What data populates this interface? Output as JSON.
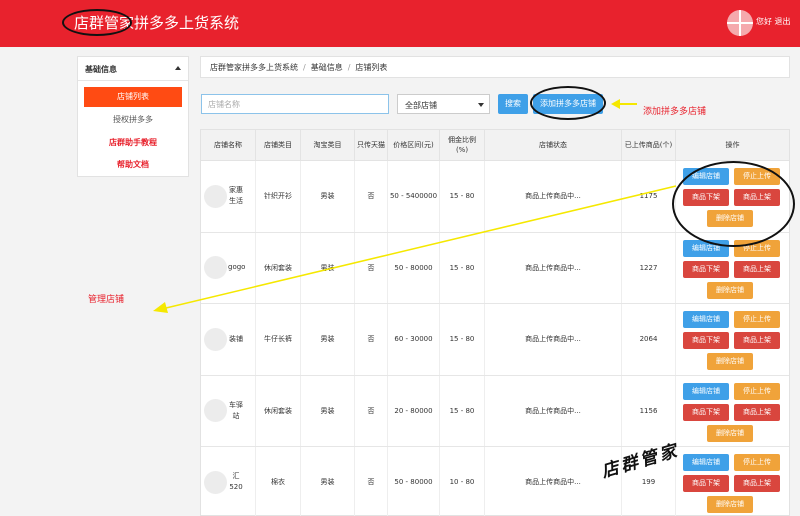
{
  "header": {
    "brand_prefix": "店群管家",
    "brand_suffix": "拼多多上货系统",
    "greeting": "您好",
    "logout": "退出"
  },
  "sidebar": {
    "section_title": "基础信息",
    "items": [
      {
        "label": "店铺列表",
        "state": "active"
      },
      {
        "label": "授权拼多多",
        "state": "normal"
      },
      {
        "label": "店群助手教程",
        "state": "highlight"
      },
      {
        "label": "帮助文档",
        "state": "highlight"
      }
    ]
  },
  "breadcrumb": {
    "items": [
      "店群管家拼多多上货系统",
      "基础信息",
      "店铺列表"
    ],
    "separator": "/"
  },
  "toolbar": {
    "search_placeholder": "店铺名称",
    "shop_select": "全部店铺",
    "search_label": "搜索",
    "add_label": "添加拼多多店铺"
  },
  "table": {
    "columns": [
      "店铺名称",
      "店铺类目",
      "淘宝类目",
      "只传天猫",
      "价格区间(元)",
      "佣金比例(%)",
      "店铺状态",
      "已上传商品(个)",
      "操作"
    ],
    "rows": [
      {
        "name": "家惠生活",
        "category": "针织开衫",
        "taobao": "男装",
        "tmall_only": "否",
        "price": "50 - 5400000",
        "commission": "15 - 80",
        "status": "商品上传商品中...",
        "uploaded": "1175"
      },
      {
        "name": "gogo",
        "category": "休闲套装",
        "taobao": "男装",
        "tmall_only": "否",
        "price": "50 - 80000",
        "commission": "15 - 80",
        "status": "商品上传商品中...",
        "uploaded": "1227"
      },
      {
        "name": "装铺",
        "category": "牛仔长裤",
        "taobao": "男装",
        "tmall_only": "否",
        "price": "60 - 30000",
        "commission": "15 - 80",
        "status": "商品上传商品中...",
        "uploaded": "2064"
      },
      {
        "name": "车驿站",
        "category": "休闲套装",
        "taobao": "男装",
        "tmall_only": "否",
        "price": "20 - 80000",
        "commission": "15 - 80",
        "status": "商品上传商品中...",
        "uploaded": "1156"
      },
      {
        "name": "汇520",
        "category": "棉衣",
        "taobao": "男装",
        "tmall_only": "否",
        "price": "50 - 80000",
        "commission": "10 - 80",
        "status": "商品上传商品中...",
        "uploaded": "199"
      }
    ],
    "actions": {
      "edit": "编辑店铺",
      "stop": "停止上传",
      "offline": "商品下架",
      "online": "商品上架",
      "delete": "删除店铺"
    }
  },
  "annotations": {
    "add_note": "添加拼多多店铺",
    "manage_note": "管理店铺",
    "watermark": "店群管家"
  },
  "colors": {
    "brand_red": "#e8222d",
    "sidebar_active": "#ff4b13",
    "button_blue": "#3fa0e8",
    "button_orange": "#f0a33a",
    "button_red": "#d9463e",
    "arrow_yellow": "#f5e800"
  }
}
